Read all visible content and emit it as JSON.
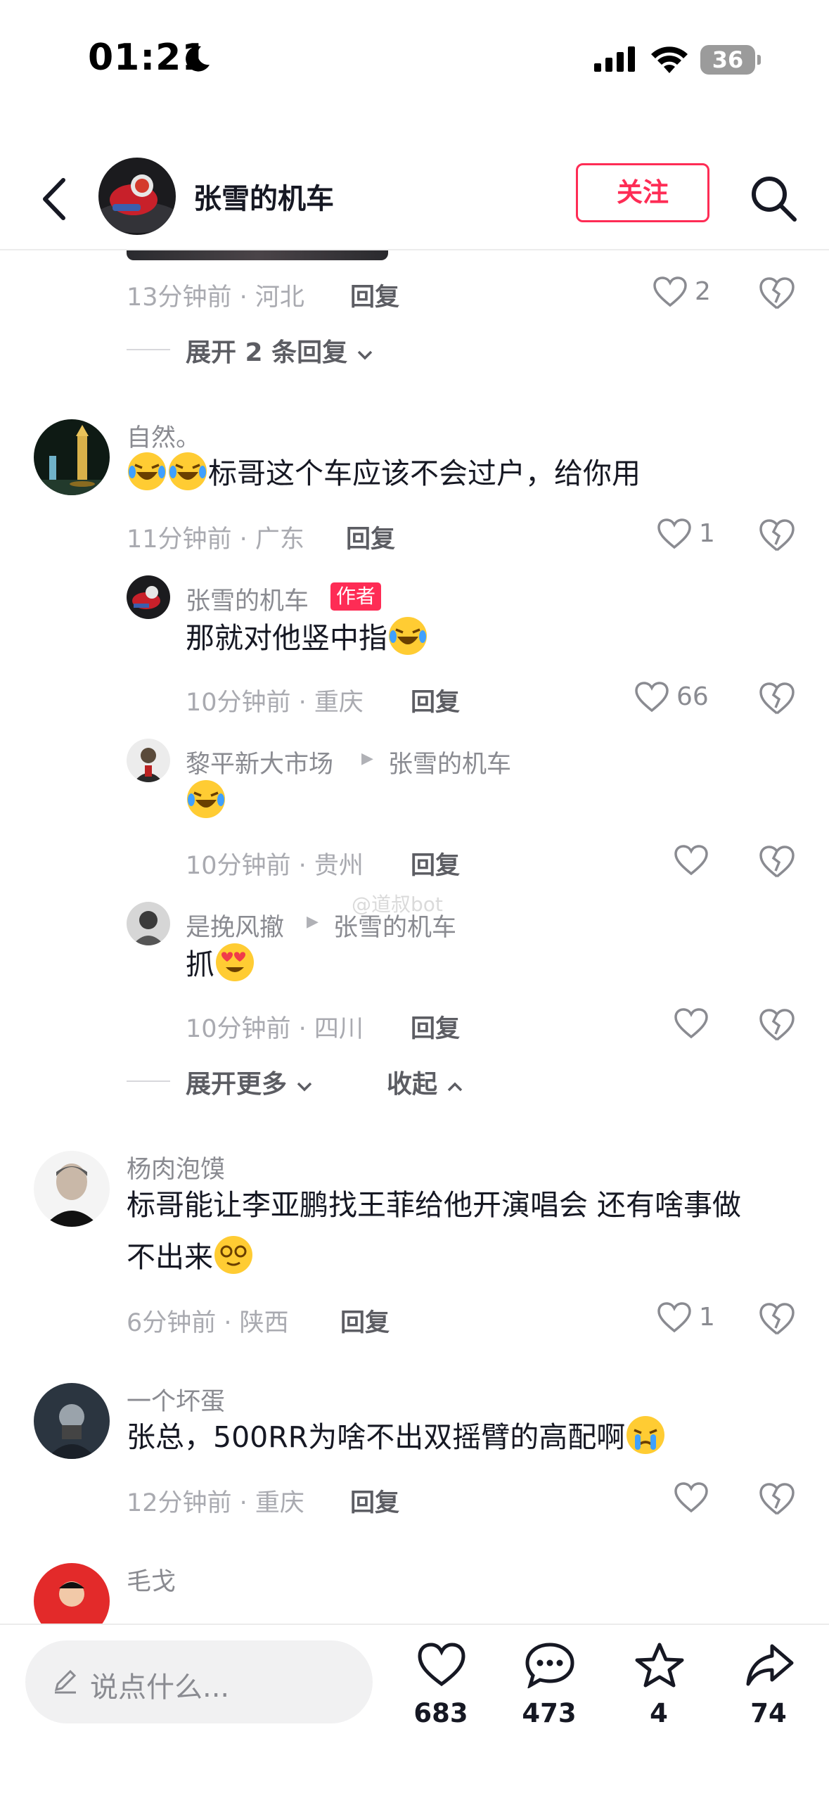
{
  "status": {
    "time": "01:21",
    "battery": "36"
  },
  "header": {
    "account_name": "张雪的机车",
    "follow_label": "关注"
  },
  "comments": {
    "top_partial": {
      "time_location": "13分钟前 · 河北",
      "reply_label": "回复",
      "likes": "2",
      "expand_label": "展开 2 条回复"
    },
    "c1": {
      "username": "自然。",
      "text": "标哥这个车应该不会过户，给你用",
      "time_location": "11分钟前 · 广东",
      "reply_label": "回复",
      "likes": "1",
      "replies": [
        {
          "username": "张雪的机车",
          "badge": "作者",
          "text": "那就对他竖中指",
          "time_location": "10分钟前 · 重庆",
          "reply_label": "回复",
          "likes": "66"
        },
        {
          "username": "黎平新大市场",
          "reply_to": "张雪的机车",
          "text": "",
          "time_location": "10分钟前 · 贵州",
          "reply_label": "回复",
          "likes": ""
        },
        {
          "username": "是挽风撤",
          "reply_to": "张雪的机车",
          "text": "抓",
          "time_location": "10分钟前 · 四川",
          "reply_label": "回复",
          "likes": ""
        }
      ],
      "expand_more": "展开更多",
      "collapse": "收起"
    },
    "c2": {
      "username": "杨肉泡馍",
      "text_line1": "标哥能让李亚鹏找王菲给他开演唱会 还有啥事做",
      "text_line2": "不出来",
      "time_location": "6分钟前 · 陕西",
      "reply_label": "回复",
      "likes": "1"
    },
    "c3": {
      "username": "一个坏蛋",
      "text": "张总，500RR为啥不出双摇臂的高配啊",
      "time_location": "12分钟前 · 重庆",
      "reply_label": "回复",
      "likes": ""
    },
    "c4": {
      "username": "毛戈"
    }
  },
  "watermark": "@道叔bot",
  "bottom_bar": {
    "input_placeholder": "说点什么...",
    "likes": "683",
    "comments": "473",
    "favorites": "4",
    "shares": "74"
  },
  "colors": {
    "accent": "#fe2c55",
    "text": "#161823",
    "meta": "#a9aab0"
  }
}
